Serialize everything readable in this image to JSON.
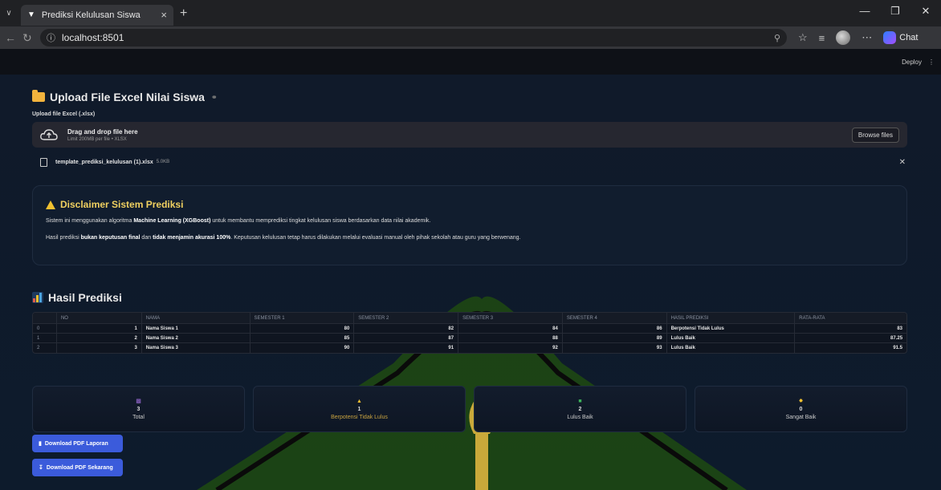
{
  "browser": {
    "tab_title": "Prediksi Kelulusan Siswa",
    "url": "localhost:8501",
    "chat_label": "Chat"
  },
  "app_header": {
    "deploy_label": "Deploy"
  },
  "upload": {
    "title": "Upload File Excel Nilai Siswa",
    "label": "Upload file Excel (.xlsx)",
    "drop_text": "Drag and drop file here",
    "limit_text": "Limit 200MB per file • XLSX",
    "browse_label": "Browse files",
    "file_name": "template_prediksi_kelulusan (1).xlsx",
    "file_size": "5.0KB"
  },
  "disclaimer": {
    "title": "Disclaimer Sistem Prediksi",
    "p1_a": "Sistem ini menggunakan algoritma ",
    "p1_b": "Machine Learning (XGBoost)",
    "p1_c": " untuk membantu memprediksi tingkat kelulusan siswa berdasarkan data nilai akademik.",
    "p2_a": "Hasil prediksi ",
    "p2_b": "bukan keputusan final",
    "p2_c": " dan ",
    "p2_d": "tidak menjamin akurasi 100%",
    "p2_e": ". Keputusan kelulusan tetap harus dilakukan melalui evaluasi manual oleh pihak sekolah atau guru yang berwenang."
  },
  "results": {
    "title": "Hasil Prediksi",
    "columns": [
      "",
      "NO",
      "NAMA",
      "SEMESTER 1",
      "SEMESTER 2",
      "SEMESTER 3",
      "SEMESTER 4",
      "HASIL PREDIKSI",
      "RATA-RATA"
    ],
    "rows": [
      [
        "0",
        "1",
        "Nama Siswa 1",
        "80",
        "82",
        "84",
        "86",
        "Berpotensi Tidak Lulus",
        "83"
      ],
      [
        "1",
        "2",
        "Nama Siswa 2",
        "85",
        "87",
        "88",
        "89",
        "Lulus Baik",
        "87.25"
      ],
      [
        "2",
        "3",
        "Nama Siswa 3",
        "90",
        "91",
        "92",
        "93",
        "Lulus Baik",
        "91.5"
      ]
    ]
  },
  "summary": [
    {
      "icon": "bar-chart-icon",
      "value": "3",
      "label": "Total",
      "color": "#9b6bd6"
    },
    {
      "icon": "warning-icon",
      "value": "1",
      "label": "Berpotensi Tidak Lulus",
      "color": "#f0c030"
    },
    {
      "icon": "check-icon",
      "value": "2",
      "label": "Lulus Baik",
      "color": "#3cb55a"
    },
    {
      "icon": "star-icon",
      "value": "0",
      "label": "Sangat Baik",
      "color": "#f0c030"
    }
  ],
  "buttons": {
    "download_report": "Download PDF Laporan",
    "download_now": "Download PDF Sekarang"
  },
  "colors": {
    "accent": "#3b5bdb",
    "background": "#0e1117",
    "panel": "#111d2e"
  }
}
